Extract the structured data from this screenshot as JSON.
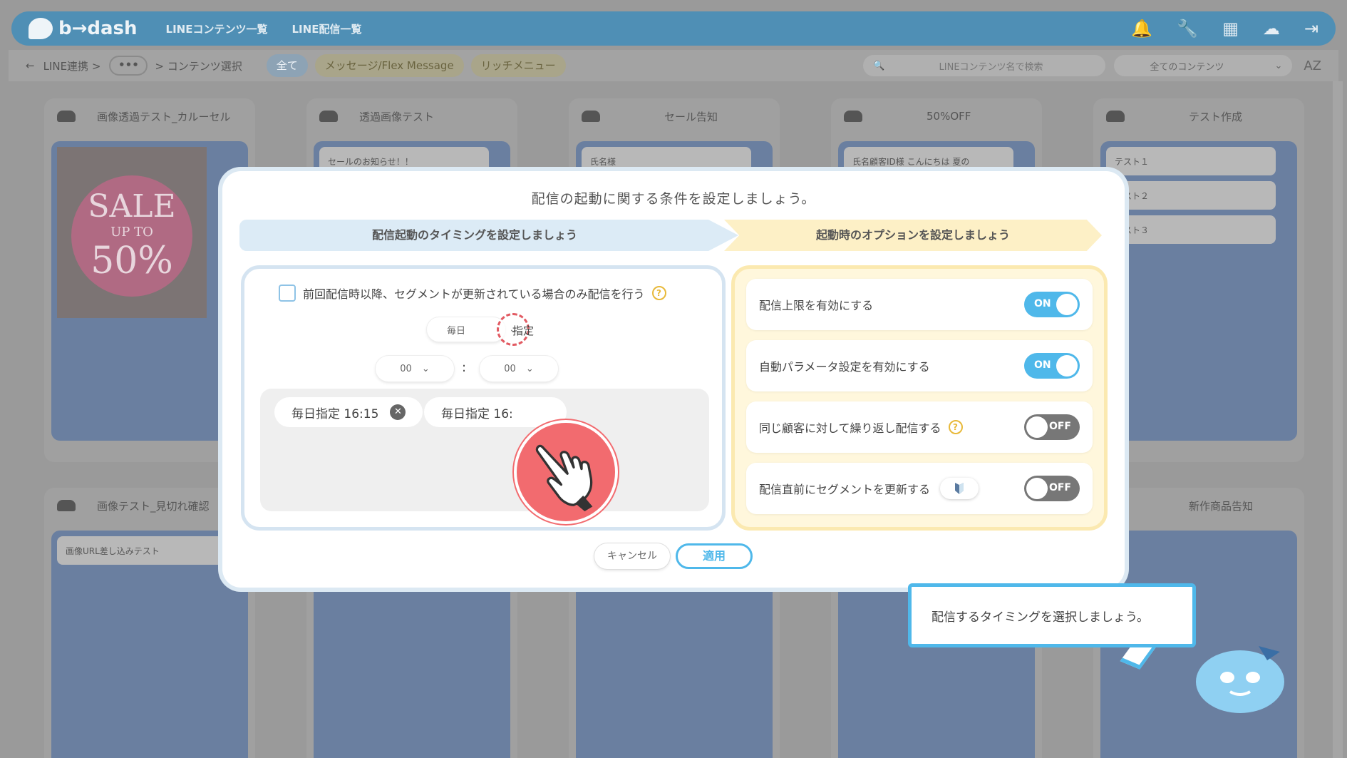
{
  "app": {
    "logo": "b→dash",
    "nav": [
      "LINEコンテンツ一覧",
      "LINE配信一覧"
    ]
  },
  "breadcrumb": {
    "back": "←",
    "items": [
      "LINE連携 >",
      "•••",
      "> コンテンツ選択"
    ]
  },
  "filter_tabs": [
    "全て",
    "メッセージ/Flex Message",
    "リッチメニュー"
  ],
  "search": {
    "placeholder": "LINEコンテンツ名で検索"
  },
  "content_filter": {
    "selected": "全てのコンテンツ"
  },
  "sort_label": "AZ",
  "background_cards": [
    {
      "title": "画像透過テスト_カルーセル"
    },
    {
      "title": "透過画像テスト",
      "bubble": "セールのお知らせ！！"
    },
    {
      "title": "セール告知",
      "bubble": "氏名様"
    },
    {
      "title": "50%OFF",
      "bubble": "氏名顧客ID様 こんにちは 夏の"
    },
    {
      "title": "テスト作成",
      "items": [
        "テスト１",
        "テスト２",
        "テスト３"
      ]
    },
    {
      "title": "画像テスト_見切れ確認",
      "bubble": "画像URL差し込みテスト"
    },
    {
      "title": "新作商品告知"
    }
  ],
  "modal": {
    "title": "配信の起動に関する条件を設定しましょう。",
    "step1": "配信起動のタイミングを設定しましょう",
    "step2": "起動時のオプションを設定しましょう",
    "segment_check_label": "前回配信時以降、セグメントが更新されている場合のみ配信を行う",
    "frequency": "毎日",
    "frequency_suffix": "指定",
    "hour": "00",
    "minute": "00",
    "time_chips": [
      "毎日指定 16:15",
      "毎日指定 16:"
    ],
    "options": [
      {
        "label": "配信上限を有効にする",
        "state": "ON"
      },
      {
        "label": "自動パラメータ設定を有効にする",
        "state": "ON"
      },
      {
        "label": "同じ顧客に対して繰り返し配信する",
        "state": "OFF"
      },
      {
        "label": "配信直前にセグメントを更新する",
        "state": "OFF"
      }
    ],
    "cancel": "キャンセル",
    "apply": "適用"
  },
  "tooltip": {
    "text": "配信するタイミングを選択しましょう。"
  },
  "colors": {
    "accent": "#4fb8ea",
    "pointer": "#f26b6f",
    "option_panel": "#fff7dc"
  }
}
